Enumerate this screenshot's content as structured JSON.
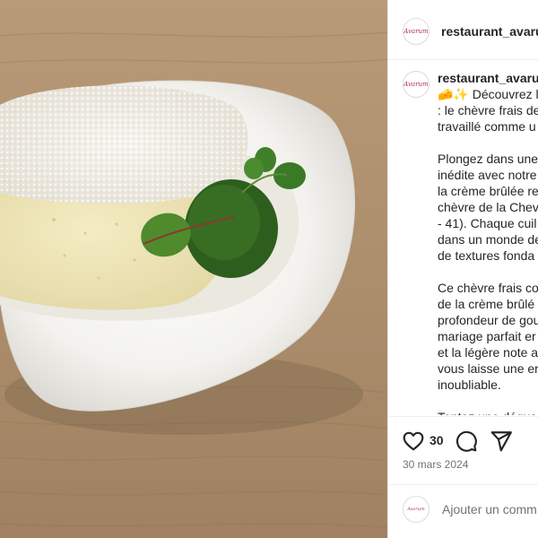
{
  "colors": {
    "logo_text": "#b0304a",
    "border": "#efefef",
    "muted_text": "#737373"
  },
  "post": {
    "username": "restaurant_avaru",
    "avatar_logo_text": "Avarum",
    "caption_paragraphs": [
      [
        "🧀✨ Découvrez l'",
        ": le chèvre frais de",
        "travaillé comme u"
      ],
      [
        "Plongez dans une",
        "inédite avec notre",
        "la crème brûlée re",
        "chèvre de la Chev",
        "- 41). Chaque cuil",
        "dans un monde de",
        "de textures fonda"
      ],
      [
        "Ce chèvre frais co",
        "de la crème brûlé",
        "profondeur de gou",
        "mariage parfait er",
        "et la légère note a",
        "vous laisse une er",
        "inoubliable."
      ],
      [
        "Tentez une dégus"
      ]
    ],
    "likes": "30",
    "date": "30 mars 2024"
  },
  "actions": {
    "like_icon": "heart-icon",
    "comment_icon": "comment-icon",
    "share_icon": "share-icon"
  },
  "comment_box": {
    "placeholder": "Ajouter un comm"
  }
}
